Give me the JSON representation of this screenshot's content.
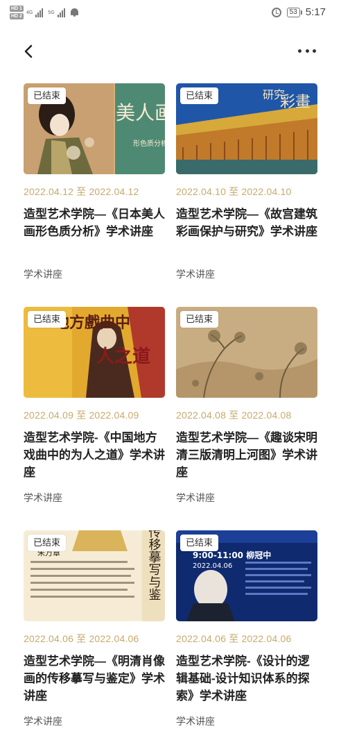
{
  "status_bar": {
    "sim1": "HD 1",
    "sim2": "HD 2",
    "network1": "4G",
    "network2": "5G",
    "battery": "53",
    "time": "5:17"
  },
  "nav": {
    "back_icon": "chevron-left-icon",
    "more_icon": "more-horizontal-icon"
  },
  "items": [
    {
      "badge": "已结束",
      "date": "2022.04.12 至 2022.04.12",
      "title": "造型艺术学院—《日本美人画形色质分析》学术讲座",
      "tag": "学术讲座",
      "thumb_text": "美人画",
      "thumb_text2": "形色质分析"
    },
    {
      "badge": "已结束",
      "date": "2022.04.10 至 2022.04.10",
      "title": "造型艺术学院—《故宫建筑彩画保护与研究》学术讲座",
      "tag": "学术讲座",
      "thumb_text": "彩畫",
      "thumb_text2": "研究"
    },
    {
      "badge": "已结束",
      "date": "2022.04.09 至 2022.04.09",
      "title": "造型艺术学院-《中国地方戏曲中的为人之道》学术讲座",
      "tag": "学术讲座",
      "thumb_text": "地方戲曲中",
      "thumb_text2": "人之道"
    },
    {
      "badge": "已结束",
      "date": "2022.04.08 至 2022.04.08",
      "title": "造型艺术学院—《趣谈宋明清三版清明上河图》学术讲座",
      "tag": "学术讲座",
      "thumb_text": "",
      "thumb_text2": ""
    },
    {
      "badge": "已结束",
      "date": "2022.04.06 至 2022.04.06",
      "title": "造型艺术学院—《明清肖像画的传移摹写与鉴定》学术讲座",
      "tag": "学术讲座",
      "thumb_text": "像画的传移摹写与鉴",
      "thumb_text2": "朱万章"
    },
    {
      "badge": "已结束",
      "date": "2022.04.06 至 2022.04.06",
      "title": "造型艺术学院-《设计的逻辑基础-设计知识体系的探索》学术讲座",
      "tag": "学术讲座",
      "thumb_text": "9:00-11:00 柳冠中",
      "thumb_text2": "2022.04.06"
    }
  ]
}
